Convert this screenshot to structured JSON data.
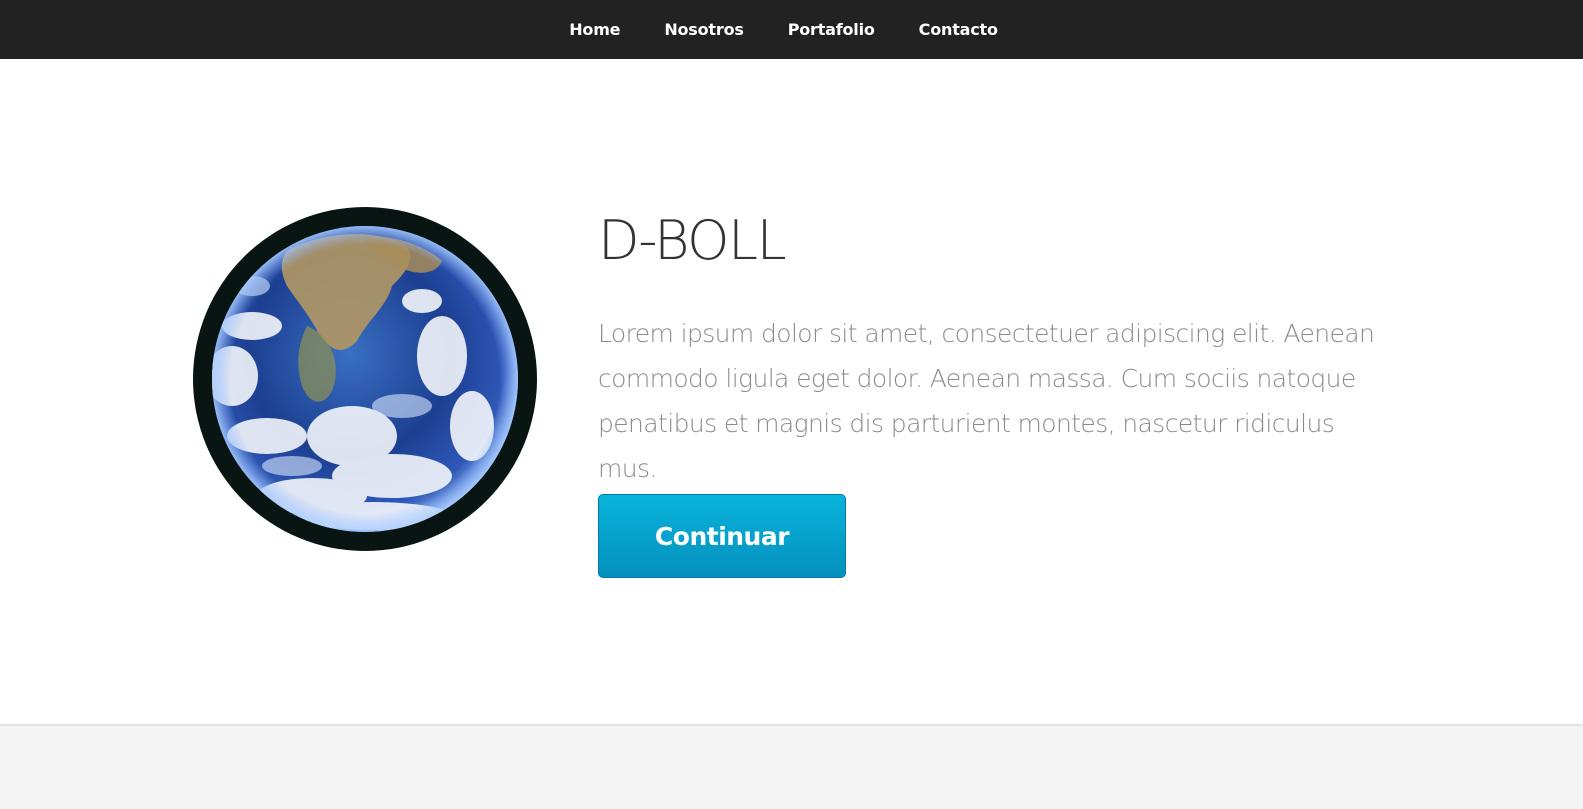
{
  "nav": {
    "items": [
      {
        "label": "Home"
      },
      {
        "label": "Nosotros"
      },
      {
        "label": "Portafolio"
      },
      {
        "label": "Contacto"
      }
    ]
  },
  "hero": {
    "title": "D-BOLL",
    "text": "Lorem ipsum dolor sit amet, consectetuer adipiscing elit. Aenean commodo ligula eget dolor. Aenean massa. Cum sociis natoque penatibus et magnis dis parturient montes, nascetur ridiculus mus.",
    "button_label": "Continuar",
    "image": "earth-globe-image"
  },
  "colors": {
    "navbar": "#222222",
    "button": "#0aa5d0",
    "title": "#333333",
    "text": "#8a8a8a"
  }
}
